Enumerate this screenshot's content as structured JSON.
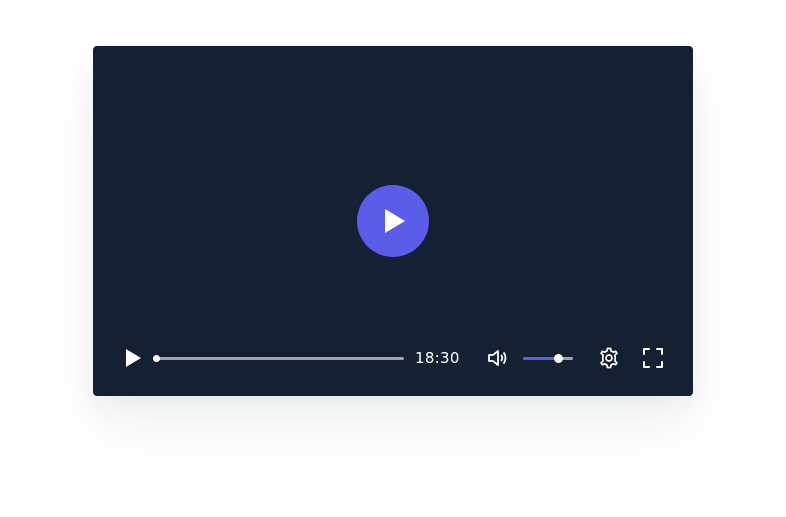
{
  "player": {
    "background_color": "#162033",
    "accent_color": "#5b5ce8",
    "big_play_icon": "play-icon",
    "controls": {
      "play_icon": "play-icon",
      "progress_fraction": 0.0,
      "time": "18:30",
      "volume_icon": "volume-icon",
      "volume_fraction": 0.7,
      "settings_icon": "gear-icon",
      "fullscreen_icon": "fullscreen-icon"
    }
  }
}
